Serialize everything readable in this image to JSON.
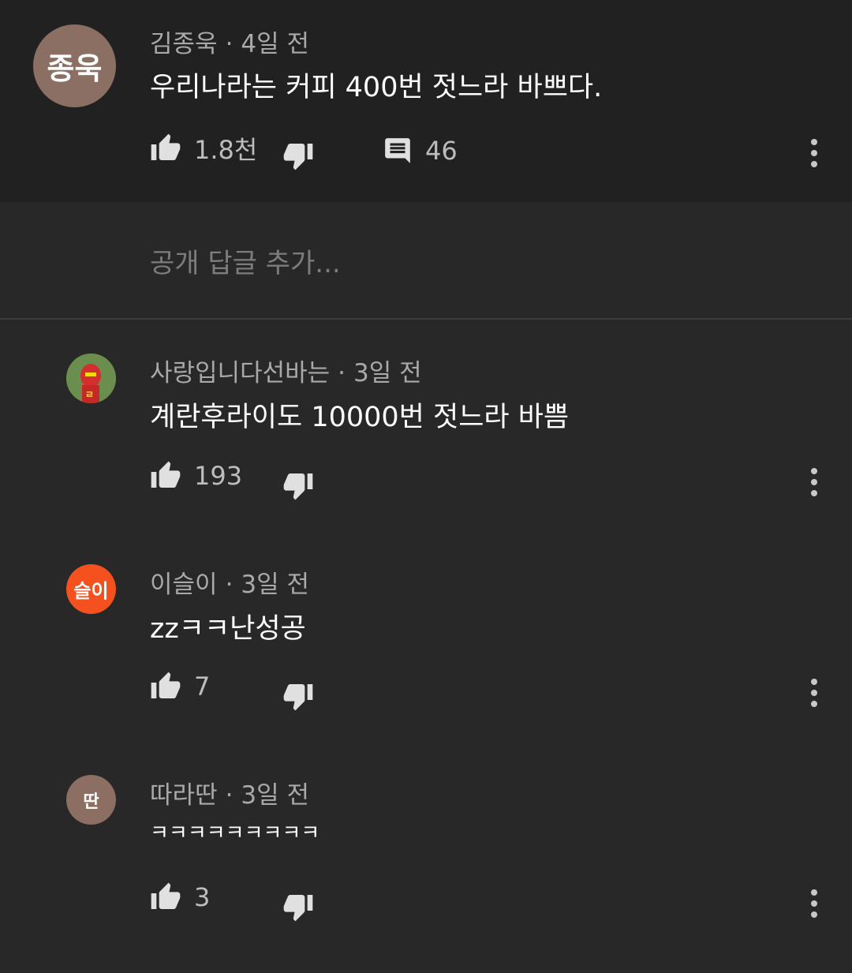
{
  "comments": [
    {
      "avatar_text": "종욱",
      "avatar_color": "#8c6f63",
      "author": "김종욱",
      "time": "4일 전",
      "text": "우리나라는 커피 400번 젓느라 바쁘다.",
      "likes": "1.8천",
      "replies": "46"
    },
    {
      "avatar_text": "",
      "avatar_color": "#5a7a3a",
      "author": "사랑입니다선바는",
      "time": "3일 전",
      "text": "계란후라이도 10000번 젓느라 바쁨",
      "likes": "193"
    },
    {
      "avatar_text": "슬이",
      "avatar_color": "#f4511e",
      "author": "이슬이",
      "time": "3일 전",
      "text": "zzㅋㅋ난성공",
      "likes": "7"
    },
    {
      "avatar_text": "딴",
      "avatar_color": "#8d6e63",
      "author": "따라딴",
      "time": "3일 전",
      "text": "ㅋㅋㅋㅋㅋㅋㅋㅋㅋ",
      "likes": "3"
    }
  ],
  "reply_placeholder": "공개 답글 추가...",
  "separator": "·"
}
